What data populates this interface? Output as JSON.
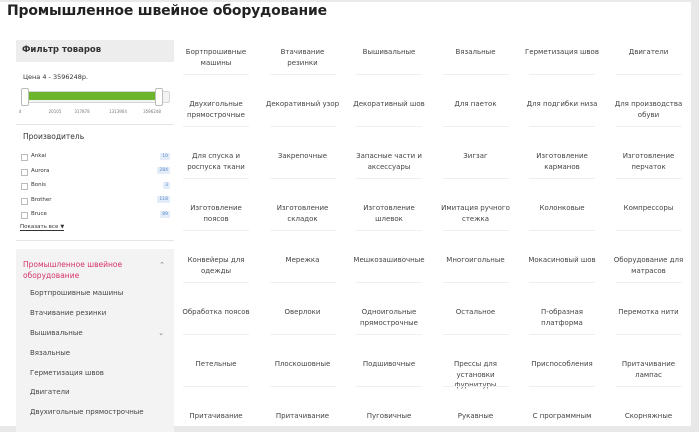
{
  "page": {
    "title": "Промышленное швейное оборудование"
  },
  "filter": {
    "title": "Фильтр товаров",
    "price_label": "Цена  4 - 3596248р.",
    "price_min": 4,
    "price_max": 3596248,
    "range_low": 4,
    "range_high": 3300000,
    "ticks": [
      "4",
      "20105",
      "317878",
      "1313904",
      "3596248"
    ]
  },
  "makers": {
    "title": "Производитель",
    "items": [
      {
        "name": "Ankai",
        "count": "10"
      },
      {
        "name": "Aurora",
        "count": "284"
      },
      {
        "name": "Bonis",
        "count": "3"
      },
      {
        "name": "Brother",
        "count": "118"
      },
      {
        "name": "Bruce",
        "count": "89"
      }
    ],
    "show_all": "Показать все"
  },
  "categories": {
    "active": "Промышленное швейное оборудование",
    "items": [
      "Бортпрошивные машины",
      "Втачивание резинки",
      "Вышивальные",
      "Вязальные",
      "Герметизация швов",
      "Двигатели",
      "Двухигольные прямострочные"
    ]
  },
  "grid": {
    "cells": [
      "Бортпрошивные машины",
      "Втачивание резинки",
      "Вышивальные",
      "Вязальные",
      "Герметизация швов",
      "Двигатели",
      "Двухигольные прямострочные",
      "Декоративный узор",
      "Декоративный шов",
      "Для паеток",
      "Для подгибки низа",
      "Для производства обуви",
      "Для спуска и роспуска ткани",
      "Закрепочные",
      "Запасные части и аксессуары",
      "Зигзаг",
      "Изготовление карманов",
      "Изготовление перчаток",
      "Изготовление поясов",
      "Изготовление складок",
      "Изготовление шлевок",
      "Имитация ручного стежка",
      "Колонковые",
      "Компрессоры",
      "Конвейеры для одежды",
      "Мережка",
      "Мешкозашивочные",
      "Многоигольные",
      "Мокасиновый шов",
      "Оборудование для матрасов",
      "Обработка поясов",
      "Оверлоки",
      "Одноигольные прямострочные",
      "Остальное",
      "П-образная платформа",
      "Перемотка нити",
      "Петельные",
      "Плоскошовные",
      "Подшивочные",
      "Прессы для установки фурнитуры",
      "Приспособления",
      "Притачивание лампас",
      "Притачивание",
      "Притачивание",
      "Пуговичные",
      "Рукавные",
      "С программным",
      "Скорняжные"
    ]
  }
}
